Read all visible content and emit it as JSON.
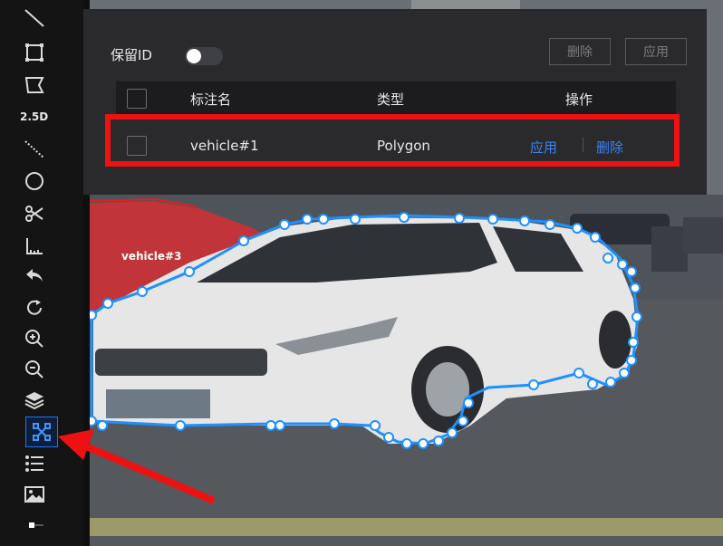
{
  "toolbar": {
    "tools": [
      {
        "name": "line-tool-icon"
      },
      {
        "name": "rectangle-tool-icon"
      },
      {
        "name": "polygon-tool-icon"
      },
      {
        "name": "cuboid-2-5d-tool-icon",
        "label": "2.5D"
      },
      {
        "name": "dashed-line-tool-icon"
      },
      {
        "name": "ellipse-tool-icon"
      },
      {
        "name": "scissors-tool-icon"
      },
      {
        "name": "ruler-tool-icon"
      },
      {
        "name": "undo-icon"
      },
      {
        "name": "redo-icon"
      },
      {
        "name": "zoom-in-icon"
      },
      {
        "name": "zoom-out-icon"
      },
      {
        "name": "layers-icon"
      },
      {
        "name": "select-points-icon",
        "active": true
      },
      {
        "name": "list-icon"
      },
      {
        "name": "image-icon"
      },
      {
        "name": "slider-icon"
      }
    ]
  },
  "panel": {
    "keep_id_label": "保留ID",
    "keep_id_enabled": false,
    "delete_label": "删除",
    "apply_label": "应用",
    "columns": [
      "标注名",
      "类型",
      "操作"
    ],
    "rows": [
      {
        "name": "vehicle#1",
        "type": "Polygon",
        "apply": "应用",
        "delete": "删除"
      }
    ]
  },
  "canvas": {
    "label_other": "vehicle#3",
    "polygon_color": "#1e90ff",
    "other_polygon_color": "#e02020"
  },
  "colors": {
    "accent": "#1677ff",
    "highlight": "#ee1111",
    "link": "#3b82f6"
  }
}
